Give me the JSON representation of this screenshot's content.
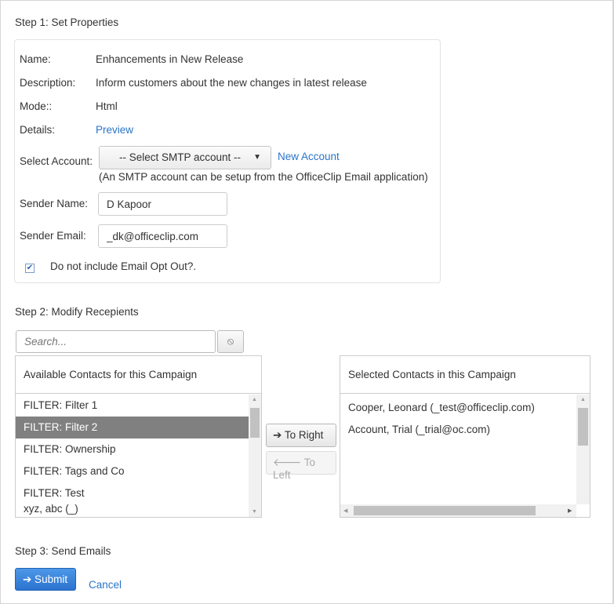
{
  "step1": {
    "title": "Step 1: Set Properties",
    "name_label": "Name:",
    "name_value": "Enhancements in New Release",
    "description_label": "Description:",
    "description_value": "Inform customers about the new changes in latest release",
    "mode_label": "Mode::",
    "mode_value": "Html",
    "details_label": "Details:",
    "details_link": "Preview",
    "account_label": "Select Account:",
    "account_select": "-- Select SMTP account --",
    "new_account_link": "New Account",
    "account_hint": "(An SMTP account can be setup from the OfficeClip Email application)",
    "sender_name_label": "Sender Name:",
    "sender_name_value": "D Kapoor",
    "sender_email_label": "Sender Email:",
    "sender_email_value": "_dk@officeclip.com",
    "optout_label": "Do not include Email Opt Out?.",
    "optout_checked": true
  },
  "step2": {
    "title": "Step 2: Modify Recepients",
    "search_placeholder": "Search...",
    "clear_icon": "⦸",
    "available_header": "Available Contacts for this Campaign",
    "available_items": [
      "FILTER: Filter 1",
      "FILTER: Filter 2",
      "FILTER: Ownership",
      "FILTER: Tags and Co",
      "FILTER: Test",
      "xyz, abc (_)"
    ],
    "selected_available": "FILTER: Filter 2",
    "to_right": "➔ To Right",
    "to_left": "🡐 To Left",
    "selected_header": "Selected Contacts in this Campaign",
    "selected_items": [
      "Cooper, Leonard (_test@officeclip.com)",
      "Account, Trial (_trial@oc.com)"
    ]
  },
  "step3": {
    "title": "Step 3: Send Emails",
    "submit": "➔ Submit",
    "cancel": "Cancel"
  }
}
